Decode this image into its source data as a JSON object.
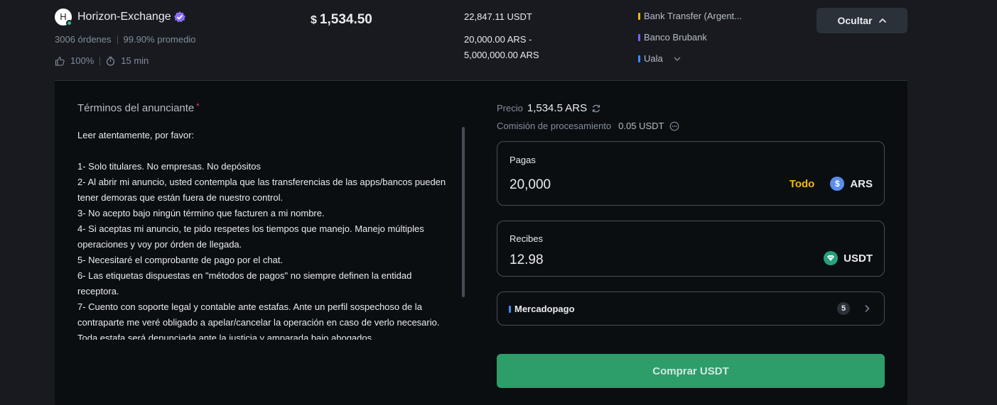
{
  "advertiser": {
    "avatar_letter": "H",
    "name": "Horizon-Exchange",
    "orders": "3006 órdenes",
    "completion": "99.90% promedio",
    "positive_rate": "100%",
    "pay_time": "15 min"
  },
  "ad": {
    "currency_symbol": "$",
    "price": "1,534.50",
    "available": "22,847.11 USDT",
    "limit_min": "20,000.00 ARS -",
    "limit_max": "5,000,000.00 ARS",
    "payment_methods": [
      {
        "label": "Bank Transfer (Argent...",
        "color": "#f0b90b"
      },
      {
        "label": "Banco Brubank",
        "color": "#7b61ff"
      },
      {
        "label": "Uala",
        "color": "#3d8bff"
      }
    ],
    "hide_label": "Ocultar"
  },
  "terms": {
    "title": "Términos del anunciante",
    "required_mark": "*",
    "lines": [
      "Leer atentamente, por favor:",
      "",
      "1- Solo titulares. No empresas. No depósitos",
      "2- Al abrir mi anuncio, usted contempla que las transferencias de las apps/bancos pueden tener demoras que están fuera de nuestro control.",
      "3- No acepto bajo ningún término que facturen a mi nombre.",
      "4- Si aceptas mi anuncio, te pido respetes los tiempos que manejo. Manejo múltiples operaciones y voy por órden de llegada.",
      "5- Necesitaré el comprobante de pago por el chat.",
      "6- Las etiquetas dispuestas en \"métodos de pagos\" no siempre definen la entidad receptora.",
      "7- Cuento con soporte legal y contable ante estafas. Ante un perfil sospechoso de la contraparte me veré obligado a apelar/cancelar la operación en caso de verlo necesario. Toda estafa será denunciada ante la justicia y amparada bajo abogados."
    ]
  },
  "order": {
    "price_label": "Precio",
    "price_value": "1,534.5 ARS",
    "fee_label": "Comisión de procesamiento",
    "fee_value": "0.05 USDT",
    "pay": {
      "label": "Pagas",
      "value": "20,000",
      "max_label": "Todo",
      "currency": "ARS"
    },
    "receive": {
      "label": "Recibes",
      "value": "12.98",
      "currency": "USDT"
    },
    "method": {
      "label": "Mercadopago",
      "count": "5"
    },
    "buy_label": "Comprar USDT"
  }
}
